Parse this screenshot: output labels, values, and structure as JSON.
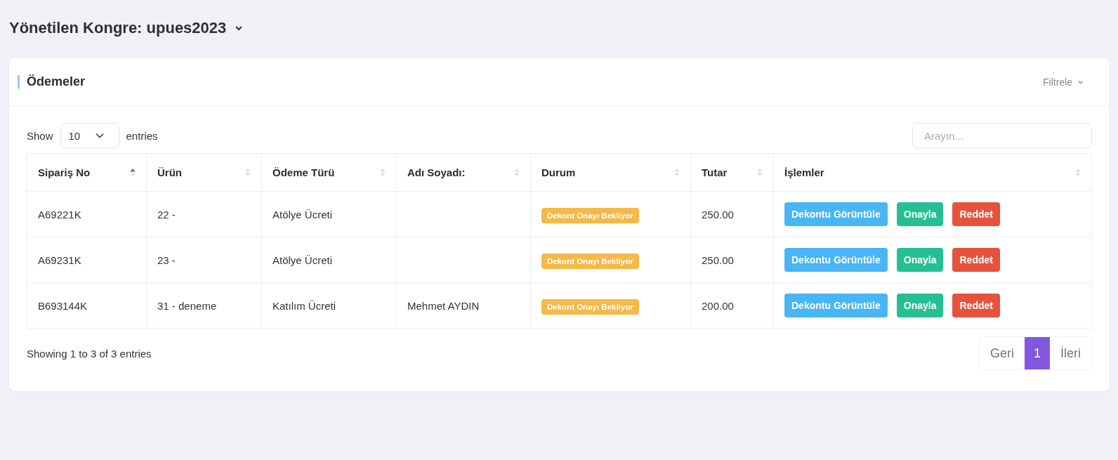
{
  "page_title": {
    "text": "Yönetilen Kongre: upues2023"
  },
  "card": {
    "title": "Ödemeler",
    "filter_label": "Filtrele",
    "length": {
      "show": "Show",
      "value": "10",
      "entries": "entries"
    },
    "search": {
      "placeholder": "Arayın..."
    },
    "table": {
      "columns": [
        {
          "label": "Sipariş No",
          "sorted": true
        },
        {
          "label": "Ürün",
          "sorted": false
        },
        {
          "label": "Ödeme Türü",
          "sorted": false
        },
        {
          "label": "Adı Soyadı:",
          "sorted": false
        },
        {
          "label": "Durum",
          "sorted": false
        },
        {
          "label": "Tutar",
          "sorted": false
        },
        {
          "label": "İşlemler",
          "sorted": false
        }
      ],
      "rows": [
        {
          "order_no": "A69221K",
          "product": "22 -",
          "payment_type": "Atölye Ücreti",
          "name": "",
          "status": "Dekont Onayı Bekliyor",
          "amount": "250.00",
          "actions": [
            {
              "label": "Dekontu Görüntüle",
              "kind": "view"
            },
            {
              "label": "Onayla",
              "kind": "approve"
            },
            {
              "label": "Reddet",
              "kind": "reject"
            }
          ]
        },
        {
          "order_no": "A69231K",
          "product": "23 -",
          "payment_type": "Atölye Ücreti",
          "name": "",
          "status": "Dekont Onayı Bekliyor",
          "amount": "250.00",
          "actions": [
            {
              "label": "Dekontu Görüntüle",
              "kind": "view"
            },
            {
              "label": "Onayla",
              "kind": "approve"
            },
            {
              "label": "Reddet",
              "kind": "reject"
            }
          ]
        },
        {
          "order_no": "B693144K",
          "product": "31 - deneme",
          "payment_type": "Katılım Ücreti",
          "name": "Mehmet AYDIN",
          "status": "Dekont Onayı Bekliyor",
          "amount": "200.00",
          "actions": [
            {
              "label": "Dekontu Görüntüle",
              "kind": "view"
            },
            {
              "label": "Onayla",
              "kind": "approve"
            },
            {
              "label": "Reddet",
              "kind": "reject"
            }
          ]
        }
      ]
    },
    "info": "Showing 1 to 3 of 3 entries",
    "pagination": [
      {
        "label": "Geri",
        "selected": false
      },
      {
        "label": "1",
        "selected": true
      },
      {
        "label": "İleri",
        "selected": false
      }
    ]
  }
}
